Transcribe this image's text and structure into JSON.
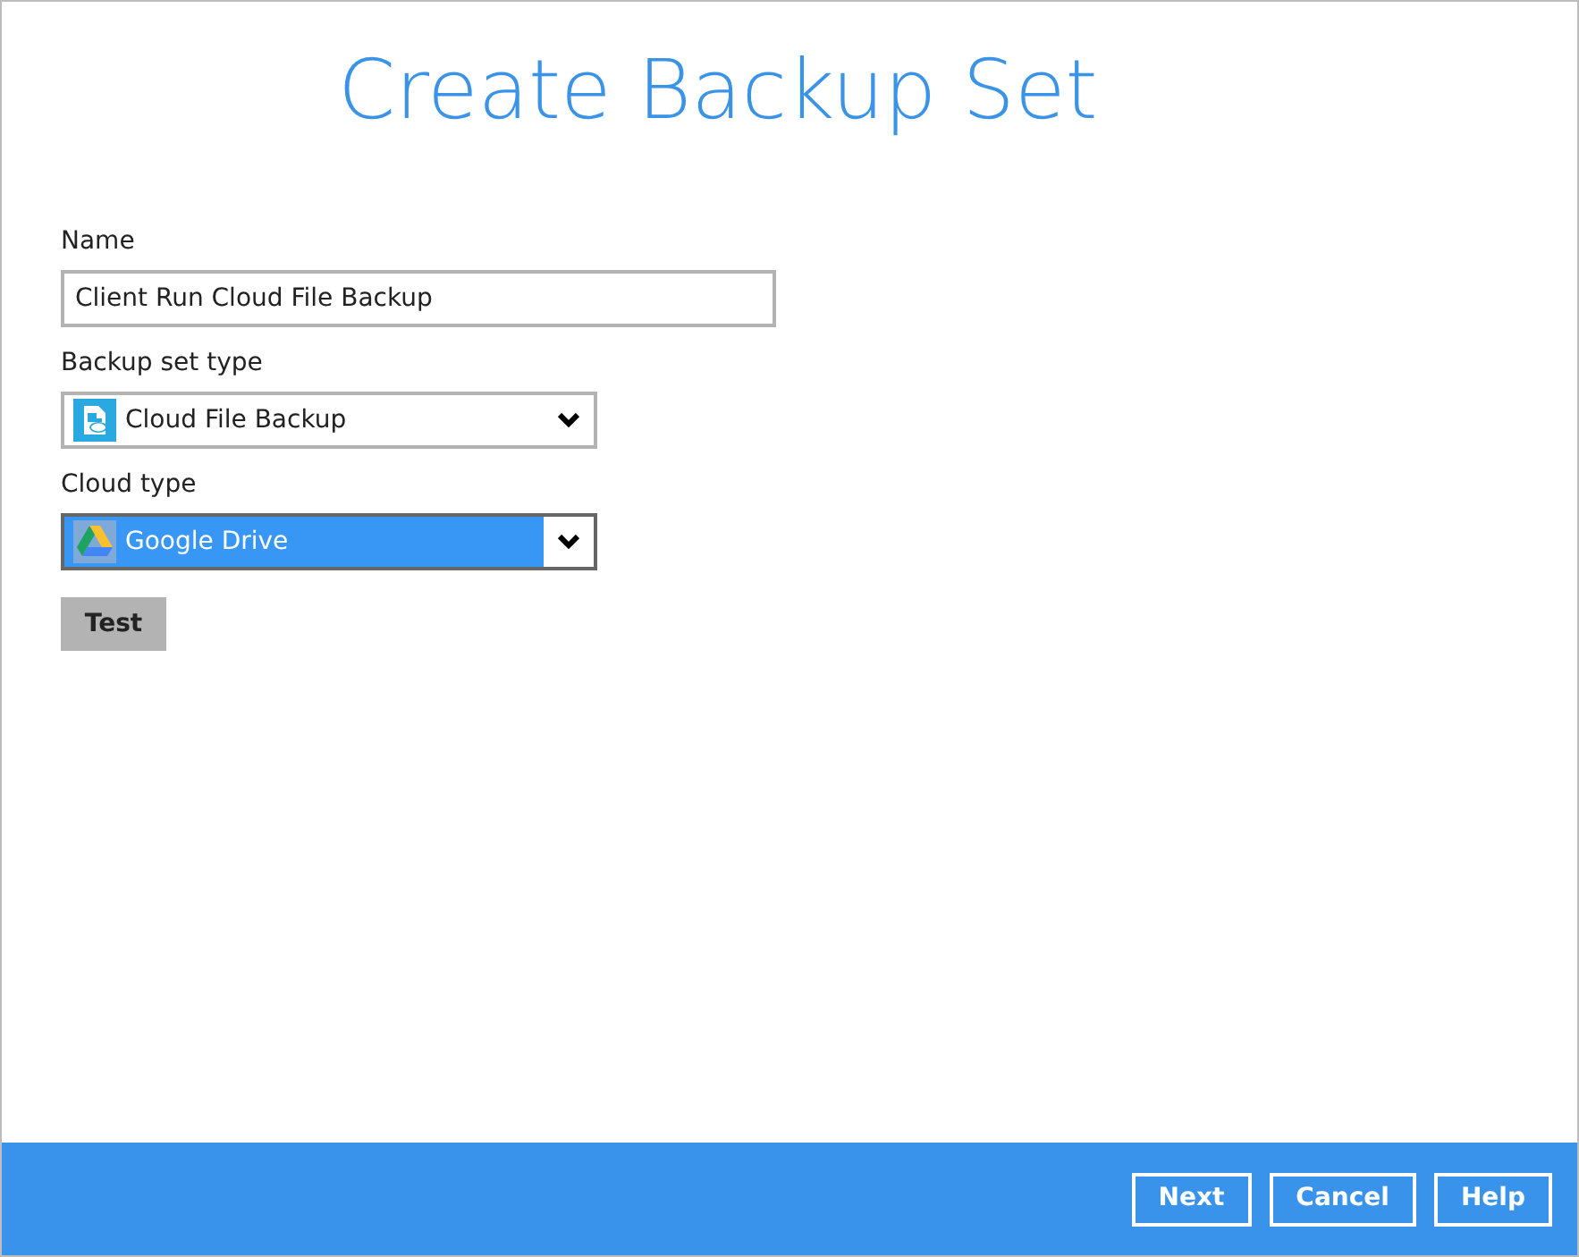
{
  "title": "Create Backup Set",
  "name_field": {
    "label": "Name",
    "value": "Client Run Cloud File Backup"
  },
  "selects": [
    {
      "label": "Backup set type",
      "value": "Cloud File Backup",
      "highlighted": false
    },
    {
      "label": "Cloud type",
      "value": "Google Drive",
      "highlighted": true
    }
  ],
  "test_button": "Test",
  "footer_buttons": [
    "Next",
    "Cancel",
    "Help"
  ]
}
